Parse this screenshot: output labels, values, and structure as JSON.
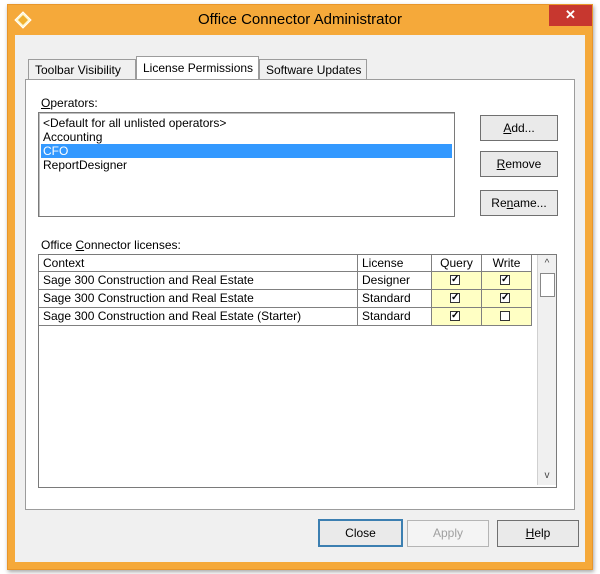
{
  "window": {
    "title": "Office Connector Administrator",
    "close_label": "✕",
    "accent_color": "#f5a93a"
  },
  "tabs": [
    {
      "label": "Toolbar Visibility",
      "active": false
    },
    {
      "label": "License Permissions",
      "active": true
    },
    {
      "label": "Software Updates",
      "active": false
    }
  ],
  "operators": {
    "label_first": "O",
    "label_rest": "perators:",
    "items": [
      {
        "label": "<Default for all unlisted operators>",
        "selected": false
      },
      {
        "label": "Accounting",
        "selected": false
      },
      {
        "label": "CFO",
        "selected": true
      },
      {
        "label": "ReportDesigner",
        "selected": false
      }
    ]
  },
  "operator_buttons": {
    "add_u": "A",
    "add_rest": "dd...",
    "remove_u": "R",
    "remove_rest": "emove",
    "rename_pre": "Re",
    "rename_u": "n",
    "rename_rest": "ame..."
  },
  "licenses": {
    "label_pre": "Office ",
    "label_u": "C",
    "label_rest": "onnector licenses:",
    "columns": [
      "Context",
      "License",
      "Query",
      "Write"
    ],
    "rows": [
      {
        "context": "Sage 300 Construction and Real Estate",
        "license": "Designer",
        "query": true,
        "write": true
      },
      {
        "context": "Sage 300 Construction and Real Estate",
        "license": "Standard",
        "query": true,
        "write": true
      },
      {
        "context": "Sage 300 Construction and Real Estate (Starter)",
        "license": "Standard",
        "query": true,
        "write": false
      }
    ],
    "scroll_up": "^",
    "scroll_down": "v",
    "check_glyph": "✓"
  },
  "footer": {
    "close": "Close",
    "apply": "Apply",
    "help_u": "H",
    "help_rest": "elp"
  }
}
